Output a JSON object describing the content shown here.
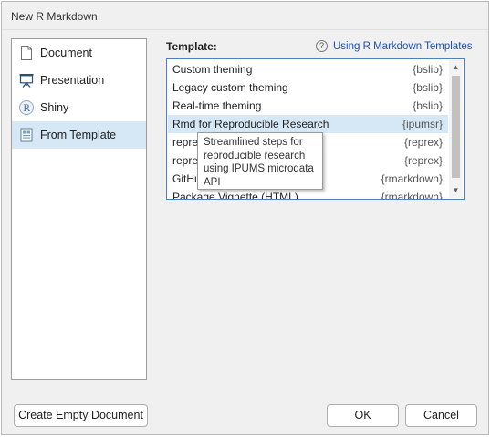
{
  "window": {
    "title": "New R Markdown"
  },
  "sidebar": {
    "items": [
      {
        "label": "Document",
        "icon": "document-icon",
        "selected": false
      },
      {
        "label": "Presentation",
        "icon": "presentation-icon",
        "selected": false
      },
      {
        "label": "Shiny",
        "icon": "shiny-r-icon",
        "selected": false
      },
      {
        "label": "From Template",
        "icon": "template-icon",
        "selected": true
      }
    ]
  },
  "main": {
    "template_label": "Template:",
    "help_link": {
      "icon": "question-circle-icon",
      "text": "Using R Markdown Templates"
    },
    "templates": [
      {
        "name": "Custom theming",
        "package": "{bslib}"
      },
      {
        "name": "Legacy custom theming",
        "package": "{bslib}"
      },
      {
        "name": "Real-time theming",
        "package": "{bslib}"
      },
      {
        "name": "Rmd for Reproducible Research",
        "package": "{ipumsr}",
        "selected": true
      },
      {
        "name": "repre",
        "package": "{reprex}"
      },
      {
        "name": "repre",
        "package": "{reprex}"
      },
      {
        "name": "GitHu",
        "package": "{rmarkdown}"
      },
      {
        "name": "Package Vignette (HTML)",
        "package": "{rmarkdown}"
      }
    ],
    "tooltip": "Streamlined steps for reproducible research using IPUMS microdata API"
  },
  "footer": {
    "create_empty": "Create Empty Document",
    "ok": "OK",
    "cancel": "Cancel"
  },
  "colors": {
    "selection": "#d6e7f5",
    "link": "#1f4fb3",
    "list_border": "#4d7fc0"
  }
}
